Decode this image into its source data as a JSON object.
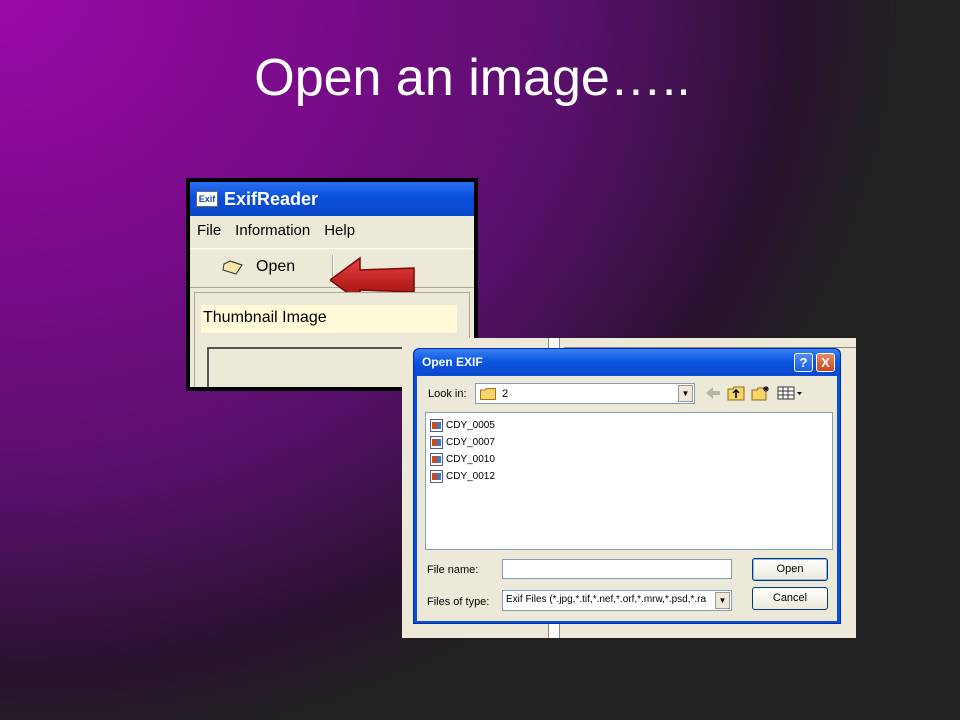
{
  "slide": {
    "title": "Open an image….."
  },
  "exifreader": {
    "title": "ExifReader",
    "icon_text": "Exif",
    "menu": [
      "File",
      "Information",
      "Help"
    ],
    "toolbar_open_label": "Open",
    "thumbnail_label": "Thumbnail Image"
  },
  "open_dialog": {
    "title": "Open EXIF",
    "help_button": "?",
    "close_button": "X",
    "look_in_label": "Look in:",
    "look_in_value": "2",
    "files": [
      "CDY_0005",
      "CDY_0007",
      "CDY_0010",
      "CDY_0012"
    ],
    "file_name_label": "File name:",
    "file_name_value": "",
    "files_of_type_label": "Files of type:",
    "files_of_type_value": "Exif Files (*.jpg,*.tif,*.nef,*.orf,*.mrw,*.psd,*.ra",
    "open_button": "Open",
    "cancel_button": "Cancel"
  },
  "colors": {
    "xp_blue": "#0a4fdc",
    "arrow_red": "#c01818",
    "thumbnail_label_bg": "#fffbd8"
  }
}
